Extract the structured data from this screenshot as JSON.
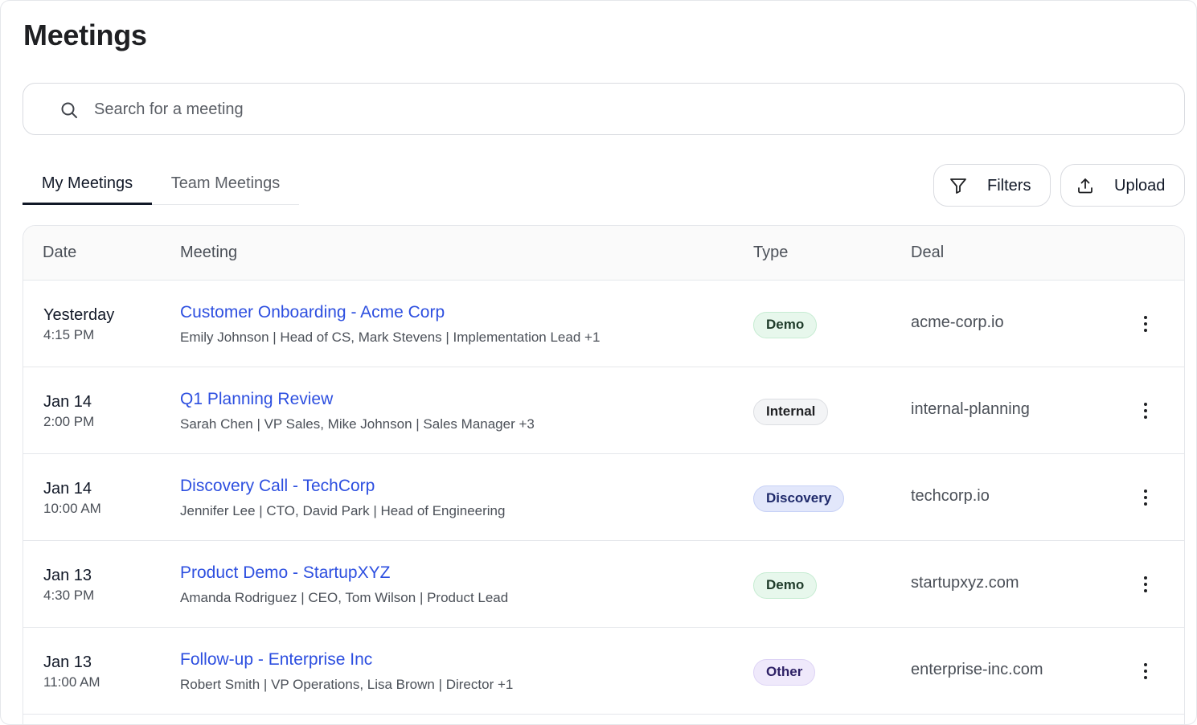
{
  "page": {
    "title": "Meetings"
  },
  "search": {
    "placeholder": "Search for a meeting",
    "value": ""
  },
  "tabs": [
    {
      "label": "My Meetings",
      "active": true
    },
    {
      "label": "Team Meetings",
      "active": false
    }
  ],
  "actions": {
    "filters_label": "Filters",
    "upload_label": "Upload"
  },
  "table": {
    "columns": [
      "Date",
      "Meeting",
      "Type",
      "Deal"
    ],
    "rows": [
      {
        "date": "Yesterday",
        "time": "4:15 PM",
        "title": "Customer Onboarding - Acme Corp",
        "attendees": "Emily Johnson | Head of CS, Mark Stevens | Implementation Lead +1",
        "type": "Demo",
        "deal": "acme-corp.io"
      },
      {
        "date": "Jan 14",
        "time": "2:00 PM",
        "title": "Q1 Planning Review",
        "attendees": "Sarah Chen | VP Sales, Mike Johnson | Sales Manager +3",
        "type": "Internal",
        "deal": "internal-planning"
      },
      {
        "date": "Jan 14",
        "time": "10:00 AM",
        "title": "Discovery Call - TechCorp",
        "attendees": "Jennifer Lee | CTO, David Park | Head of Engineering",
        "type": "Discovery",
        "deal": "techcorp.io"
      },
      {
        "date": "Jan 13",
        "time": "4:30 PM",
        "title": "Product Demo - StartupXYZ",
        "attendees": "Amanda Rodriguez | CEO, Tom Wilson | Product Lead",
        "type": "Demo",
        "deal": "startupxyz.com"
      },
      {
        "date": "Jan 13",
        "time": "11:00 AM",
        "title": "Follow-up - Enterprise Inc",
        "attendees": "Robert Smith | VP Operations, Lisa Brown | Director +1",
        "type": "Other",
        "deal": "enterprise-inc.com"
      }
    ]
  },
  "colors": {
    "link": "#2d4fe0",
    "demo": "#e7f7ec",
    "internal": "#f3f4f6",
    "discovery": "#e2e7fb",
    "other": "#efe9fb"
  },
  "icons": {
    "search": "search-icon",
    "filters": "filter-icon",
    "upload": "upload-icon",
    "row_menu": "more-vertical-icon"
  }
}
